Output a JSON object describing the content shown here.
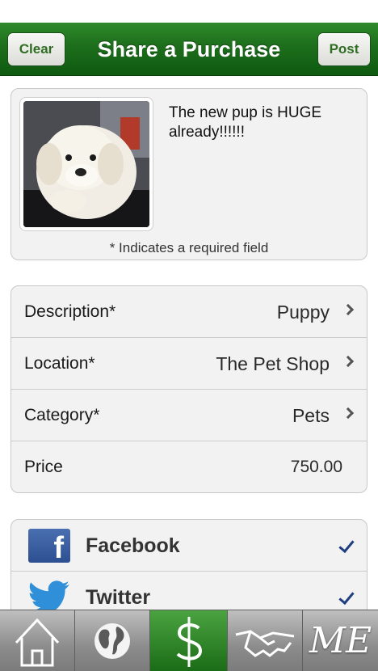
{
  "navbar": {
    "title": "Share a Purchase",
    "left_button": "Clear",
    "right_button": "Post"
  },
  "photo_card": {
    "caption": "The new pup is HUGE already!!!!!!",
    "required_note": "* Indicates a required field"
  },
  "form": {
    "rows": [
      {
        "label": "Description*",
        "value": "Puppy"
      },
      {
        "label": "Location*",
        "value": "The Pet Shop"
      },
      {
        "label": "Category*",
        "value": "Pets"
      },
      {
        "label": "Price",
        "value": "750.00"
      }
    ]
  },
  "share": {
    "items": [
      {
        "label": "Facebook",
        "icon": "facebook-icon",
        "checked": true
      },
      {
        "label": "Twitter",
        "icon": "twitter-icon",
        "checked": true
      }
    ]
  },
  "tabbar": {
    "items": [
      {
        "icon": "home-icon"
      },
      {
        "icon": "globe-icon"
      },
      {
        "icon": "dollar-icon",
        "active": true
      },
      {
        "icon": "handshake-icon"
      },
      {
        "icon": "me-icon",
        "label": "ME"
      }
    ]
  },
  "colors": {
    "navbar_green": "#1d6e1c",
    "active_tab_green": "#2f8a2a",
    "check_blue": "#1e3f80"
  }
}
